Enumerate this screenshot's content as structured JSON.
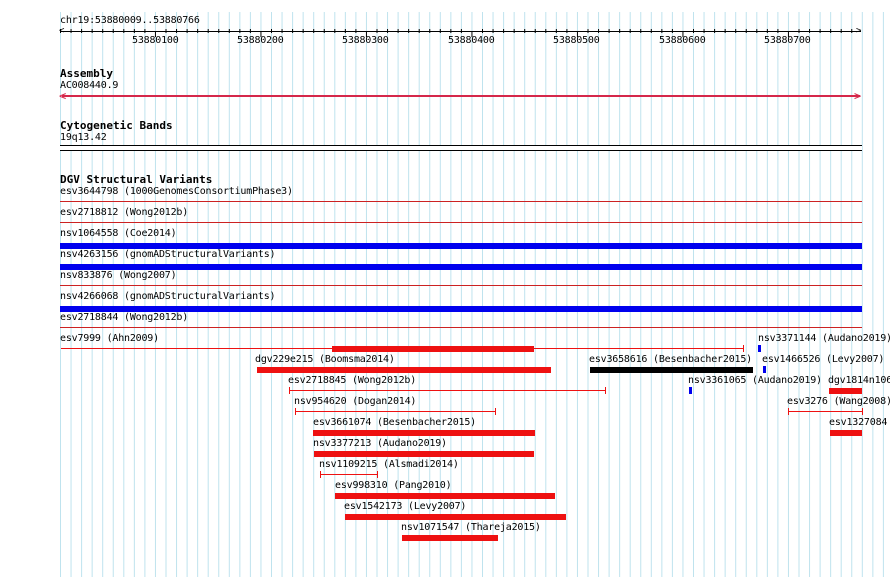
{
  "ruler": {
    "location": "chr19:53880009..53880766",
    "ticks": [
      "53880100",
      "53880200",
      "53880300",
      "53880400",
      "53880500",
      "53880600",
      "53880700"
    ]
  },
  "assembly": {
    "title": "Assembly",
    "name": "AC008440.9",
    "color": "#d5274a"
  },
  "cytoband": {
    "title": "Cytogenetic Bands",
    "band": "19q13.42"
  },
  "dgv": {
    "title": "DGV Structural Variants",
    "colors": {
      "loss": "#ee1111",
      "gain": "#0000ee",
      "complex": "#000000",
      "rowline": "#cc2222"
    },
    "rows": [
      {
        "label": "esv3644798 (1000GenomesConsortiumPhase3)",
        "type": "loss"
      },
      {
        "label": "esv2718812 (Wong2012b)",
        "type": "loss"
      },
      {
        "label": "nsv1064558 (Coe2014)",
        "type": "gain"
      },
      {
        "label": "nsv4263156 (gnomADStructuralVariants)",
        "type": "gain"
      },
      {
        "label": "nsv833876 (Wong2007)",
        "type": "loss"
      },
      {
        "label": "nsv4266068 (gnomADStructuralVariants)",
        "type": "gain"
      },
      {
        "label": "esv2718844 (Wong2012b)",
        "type": "loss"
      }
    ],
    "variants": [
      {
        "label": "esv7999 (Ahn2009)"
      },
      {
        "label": "nsv3371144 (Audano2019)"
      },
      {
        "label": "dgv229e215 (Boomsma2014)"
      },
      {
        "label": "esv3658616 (Besenbacher2015)"
      },
      {
        "label": "esv1466526 (Levy2007)"
      },
      {
        "label": "esv2718845 (Wong2012b)"
      },
      {
        "label": "nsv3361065 (Audano2019)"
      },
      {
        "label": "dgv1814n106"
      },
      {
        "label": "nsv954620 (Dogan2014)"
      },
      {
        "label": "esv3276 (Wang2008)"
      },
      {
        "label": "esv3661074 (Besenbacher2015)"
      },
      {
        "label": "esv1327084"
      },
      {
        "label": "nsv3377213 (Audano2019)"
      },
      {
        "label": "nsv1109215 (Alsmadi2014)"
      },
      {
        "label": "esv998310 (Pang2010)"
      },
      {
        "label": "esv1542173 (Levy2007)"
      },
      {
        "label": "nsv1071547 (Thareja2015)"
      }
    ]
  }
}
